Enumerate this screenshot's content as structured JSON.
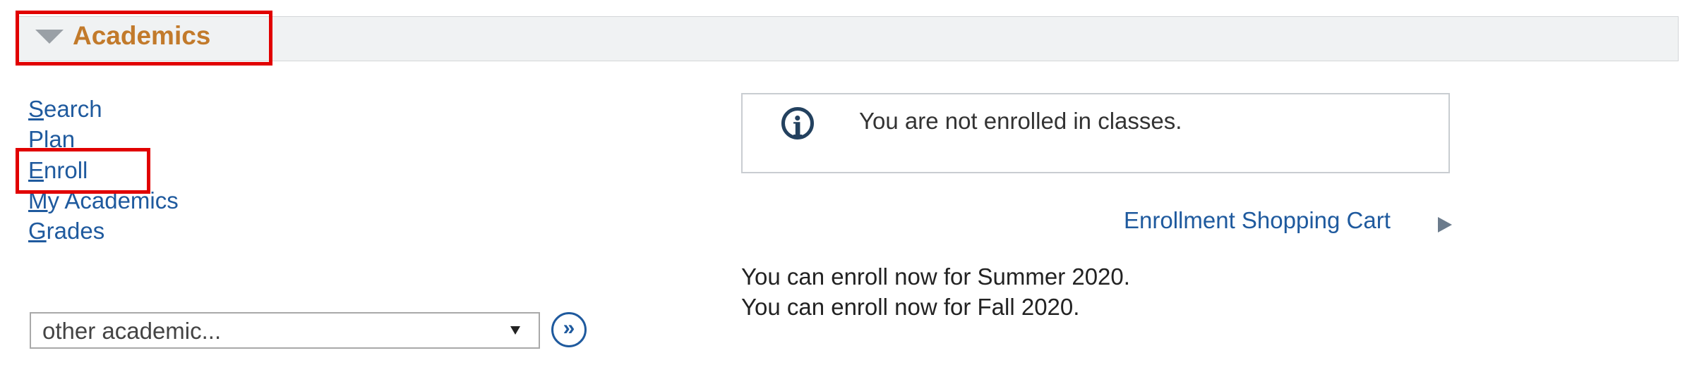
{
  "header": {
    "title": "Academics",
    "caret_icon": "triangle-down-icon"
  },
  "nav": {
    "items": [
      {
        "accel": "S",
        "rest": "earch"
      },
      {
        "accel": "P",
        "rest": "lan"
      },
      {
        "accel": "E",
        "rest": "nroll"
      },
      {
        "accel": "M",
        "rest": "y Academics"
      },
      {
        "accel": "G",
        "rest": "rades"
      }
    ]
  },
  "info": {
    "message": "You are not enrolled in classes.",
    "icon": "info-icon"
  },
  "cart": {
    "label": "Enrollment Shopping Cart",
    "arrow_icon": "play-arrow-icon"
  },
  "enroll_messages": [
    "You can enroll now for Summer 2020.",
    "You can enroll now for Fall 2020."
  ],
  "other_select": {
    "value": "other academic..."
  },
  "go_button": {
    "glyph": "»"
  },
  "colors": {
    "highlight_box": "#e10000",
    "link": "#1f5a9e",
    "header_title": "#c27a2b",
    "header_bg": "#f0f2f3"
  }
}
